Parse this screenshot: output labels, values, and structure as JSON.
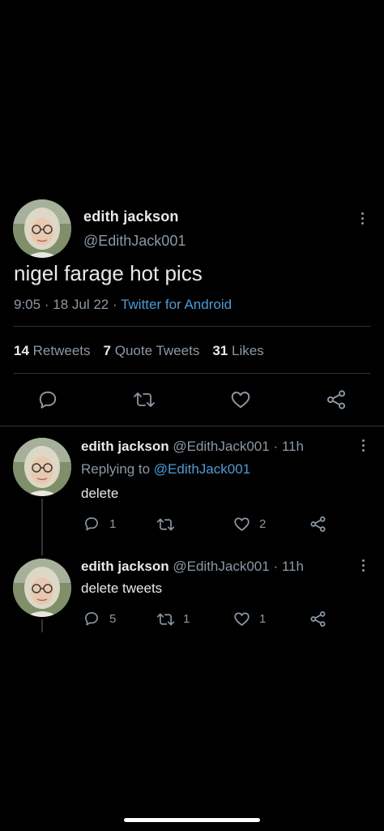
{
  "main_tweet": {
    "author_name": "edith jackson",
    "handle": "@EdithJack001",
    "text": "nigel farage hot pics",
    "time": "9:05",
    "date": "18 Jul 22",
    "source": "Twitter for Android",
    "separator": "·",
    "stats": {
      "retweets_count": "14",
      "retweets_label": "Retweets",
      "quotes_count": "7",
      "quotes_label": "Quote Tweets",
      "likes_count": "31",
      "likes_label": "Likes"
    },
    "actions": [
      "reply-icon",
      "retweet-icon",
      "like-icon",
      "share-icon"
    ]
  },
  "replies": [
    {
      "author_name": "edith jackson",
      "handle": "@EdithJack001",
      "time": "· 11h",
      "replying_to_label": "Replying to",
      "replying_to_handle": "@EdithJack001",
      "text": "delete",
      "reply_count": "1",
      "retweet_count": "",
      "like_count": "2"
    },
    {
      "author_name": "edith jackson",
      "handle": "@EdithJack001",
      "time": "· 11h",
      "text": "delete tweets",
      "reply_count": "5",
      "retweet_count": "1",
      "like_count": "1"
    }
  ],
  "colors": {
    "background": "#000000",
    "primary_text": "#e7e9ea",
    "secondary_text": "#8b98a5",
    "link": "#4e9bd8",
    "divider": "#2f3336"
  }
}
